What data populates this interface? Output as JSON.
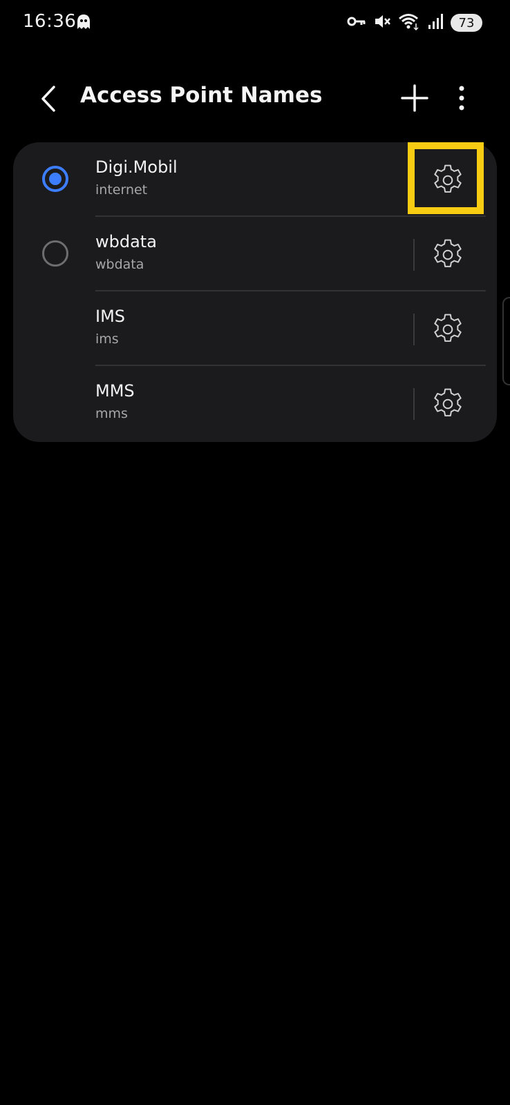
{
  "status_bar": {
    "time": "16:36",
    "battery": "73",
    "icons": [
      "ghost-icon",
      "vpn-key-icon",
      "mute-icon",
      "wifi-icon",
      "signal-icon"
    ]
  },
  "header": {
    "title": "Access Point Names",
    "back_icon": "chevron-left-icon",
    "add_icon": "plus-icon",
    "more_icon": "more-vert-icon"
  },
  "apn_list": [
    {
      "name": "Digi.Mobil",
      "apn": "internet",
      "radio": "checked"
    },
    {
      "name": "wbdata",
      "apn": "wbdata",
      "radio": "unchecked"
    },
    {
      "name": "IMS",
      "apn": "ims",
      "radio": "none"
    },
    {
      "name": "MMS",
      "apn": "mms",
      "radio": "none"
    }
  ],
  "colors": {
    "accent": "#3d7dff",
    "highlight": "#f8cc13",
    "card_bg": "#1b1b1d",
    "background": "#000000"
  }
}
